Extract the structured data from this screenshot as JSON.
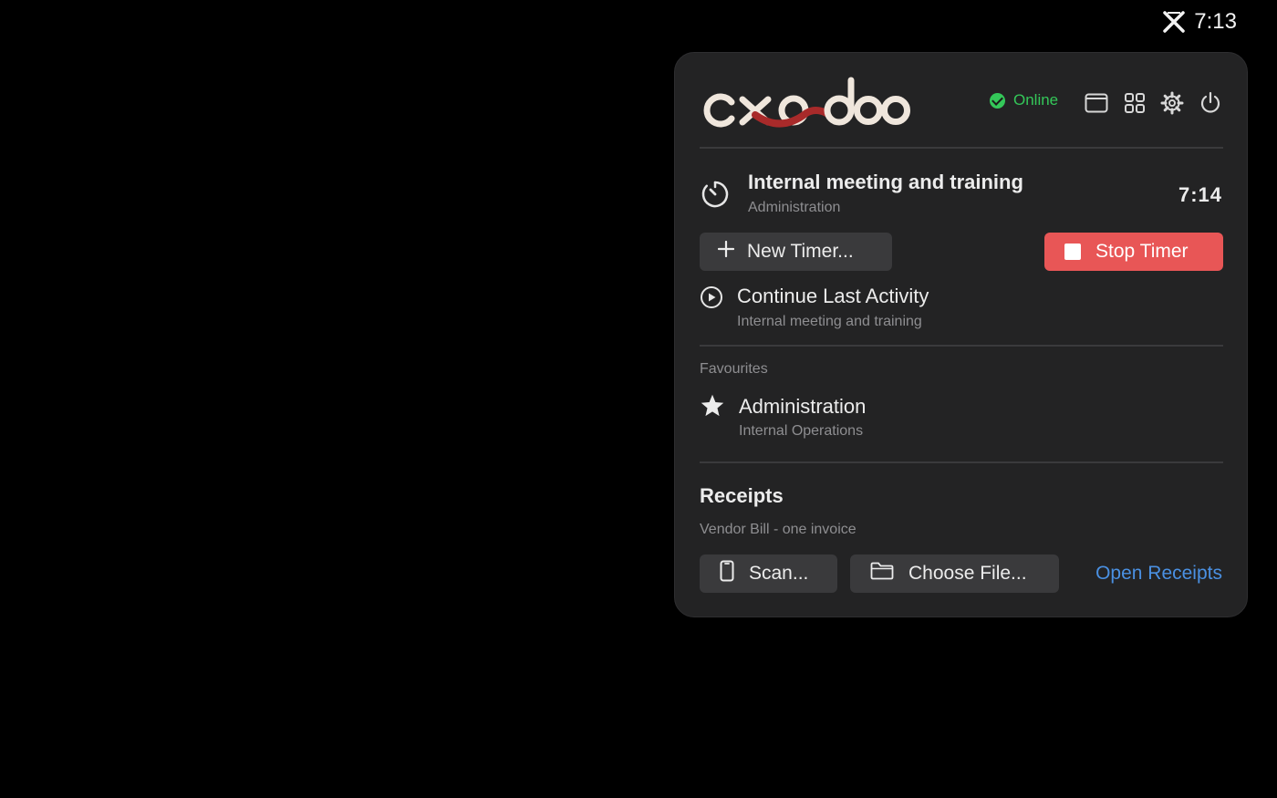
{
  "menubar": {
    "clock": "7:13",
    "app_icon": "x-logo-icon"
  },
  "header": {
    "logo_text": "cxodoo",
    "status": "Online",
    "status_color": "#34c759",
    "icons": [
      "window-icon",
      "grid-icon",
      "gear-icon",
      "power-icon"
    ]
  },
  "active_timer": {
    "title": "Internal meeting and training",
    "subtitle": "Administration",
    "elapsed": "7:14"
  },
  "actions": {
    "new_timer": "New Timer...",
    "stop_timer": "Stop Timer",
    "stop_color": "#e85656"
  },
  "continue_last": {
    "title": "Continue Last Activity",
    "subtitle": "Internal meeting and training"
  },
  "favourites": {
    "header": "Favourites",
    "items": [
      {
        "title": "Administration",
        "subtitle": "Internal Operations"
      }
    ]
  },
  "receipts": {
    "title": "Receipts",
    "subtitle": "Vendor Bill - one invoice",
    "scan": "Scan...",
    "choose_file": "Choose File...",
    "open": "Open Receipts",
    "link_color": "#4a90e2"
  }
}
